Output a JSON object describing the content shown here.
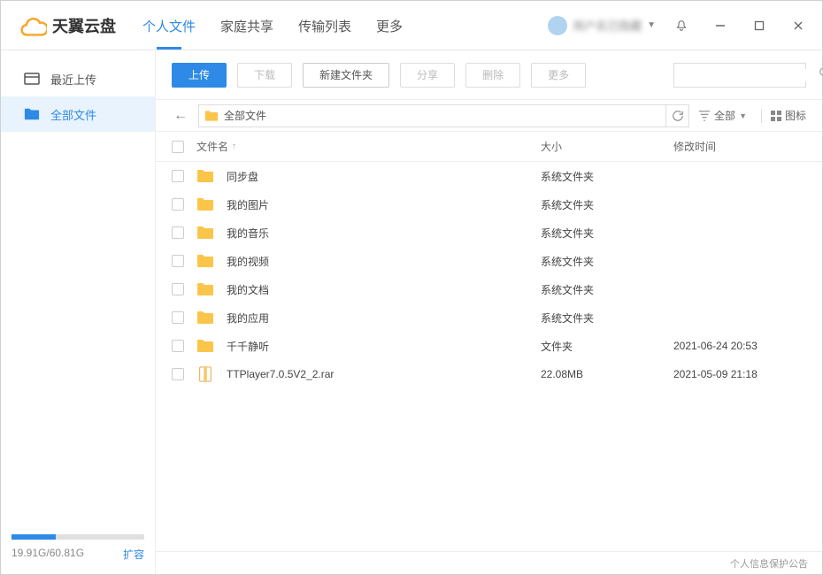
{
  "app": {
    "name": "天翼云盘"
  },
  "tabs": [
    {
      "label": "个人文件",
      "active": true
    },
    {
      "label": "家庭共享",
      "active": false
    },
    {
      "label": "传输列表",
      "active": false
    },
    {
      "label": "更多",
      "active": false
    }
  ],
  "user": {
    "name": "用户名已隐藏"
  },
  "sidebar": {
    "items": [
      {
        "label": "最近上传",
        "icon": "recent",
        "active": false
      },
      {
        "label": "全部文件",
        "icon": "folder",
        "active": true
      }
    ],
    "storage": {
      "used": "19.91G",
      "total": "60.81G",
      "percent": 33,
      "text": "19.91G/60.81G",
      "expand": "扩容"
    }
  },
  "toolbar": {
    "upload": "上传",
    "download": "下载",
    "newfolder": "新建文件夹",
    "share": "分享",
    "delete": "删除",
    "more": "更多"
  },
  "pathbar": {
    "path": "全部文件",
    "filter": "全部",
    "view": "图标"
  },
  "columns": {
    "name": "文件名",
    "size": "大小",
    "time": "修改时间"
  },
  "files": [
    {
      "name": "同步盘",
      "type": "folder",
      "size": "系统文件夹",
      "time": ""
    },
    {
      "name": "我的图片",
      "type": "folder",
      "size": "系统文件夹",
      "time": ""
    },
    {
      "name": "我的音乐",
      "type": "folder",
      "size": "系统文件夹",
      "time": ""
    },
    {
      "name": "我的视频",
      "type": "folder",
      "size": "系统文件夹",
      "time": ""
    },
    {
      "name": "我的文档",
      "type": "folder",
      "size": "系统文件夹",
      "time": ""
    },
    {
      "name": "我的应用",
      "type": "folder",
      "size": "系统文件夹",
      "time": ""
    },
    {
      "name": "千千静听",
      "type": "folder",
      "size": "文件夹",
      "time": "2021-06-24 20:53"
    },
    {
      "name": "TTPlayer7.0.5V2_2.rar",
      "type": "rar",
      "size": "22.08MB",
      "time": "2021-05-09 21:18"
    }
  ],
  "footer": {
    "notice": "个人信息保护公告"
  }
}
